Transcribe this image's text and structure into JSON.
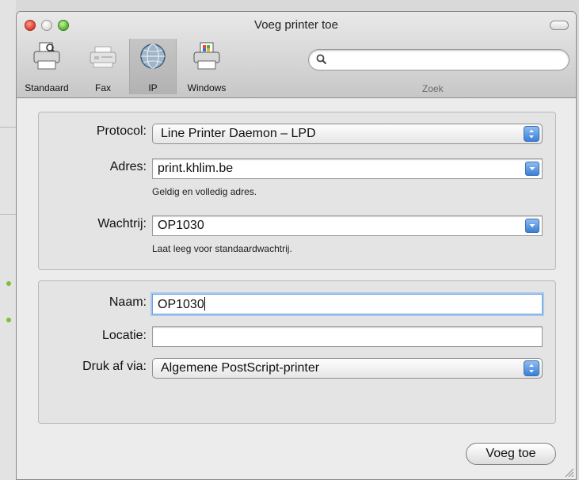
{
  "window": {
    "title": "Voeg printer toe"
  },
  "toolbar": {
    "items": [
      {
        "label": "Standaard",
        "icon": "printer-default-icon"
      },
      {
        "label": "Fax",
        "icon": "fax-icon"
      },
      {
        "label": "IP",
        "icon": "globe-icon"
      },
      {
        "label": "Windows",
        "icon": "windows-printer-icon"
      }
    ],
    "selected": "IP",
    "search": {
      "label": "Zoek",
      "value": ""
    }
  },
  "form": {
    "protocol": {
      "label": "Protocol:",
      "value": "Line Printer Daemon – LPD"
    },
    "address": {
      "label": "Adres:",
      "value": "print.khlim.be",
      "hint": "Geldig en volledig adres."
    },
    "queue": {
      "label": "Wachtrij:",
      "value": "OP1030",
      "hint": "Laat leeg voor standaardwachtrij."
    },
    "name": {
      "label": "Naam:",
      "value": "OP1030"
    },
    "location": {
      "label": "Locatie:",
      "value": ""
    },
    "print_via": {
      "label": "Druk af via:",
      "value": "Algemene PostScript-printer"
    }
  },
  "footer": {
    "add_button": "Voeg toe"
  },
  "colors": {
    "accent_blue": "#3b7fd6",
    "focus_ring": "#a8c9ef"
  }
}
